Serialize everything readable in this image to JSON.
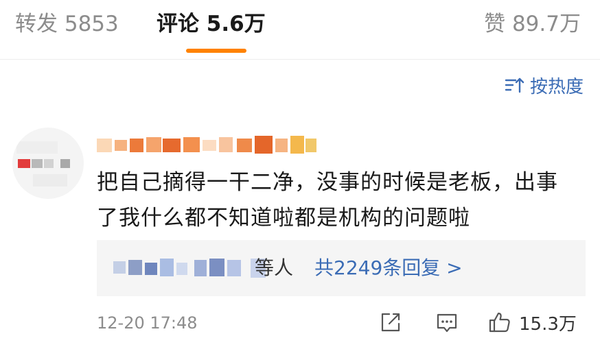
{
  "tabs": {
    "repost": "转发 5853",
    "comments": "评论 5.6万",
    "likes": "赞 89.7万"
  },
  "colors": {
    "accent": "#ff8200",
    "link": "#3b6cb5"
  },
  "sort": {
    "icon": "sort-icon",
    "label": "按热度"
  },
  "comment": {
    "avatar": "blurred-avatar",
    "username": "blurred-username",
    "text": "把自己摘得一干二净，没事的时候是老板，出事了我什么都不知道啦都是机构的问题啦",
    "replies": {
      "suffix": "等人",
      "link": "共2249条回复 >"
    },
    "timestamp": "12-20 17:48",
    "actions": {
      "share_icon": "share-icon",
      "comment_icon": "comment-icon",
      "like_icon": "thumbs-up-icon",
      "like_count": "15.3万"
    }
  }
}
